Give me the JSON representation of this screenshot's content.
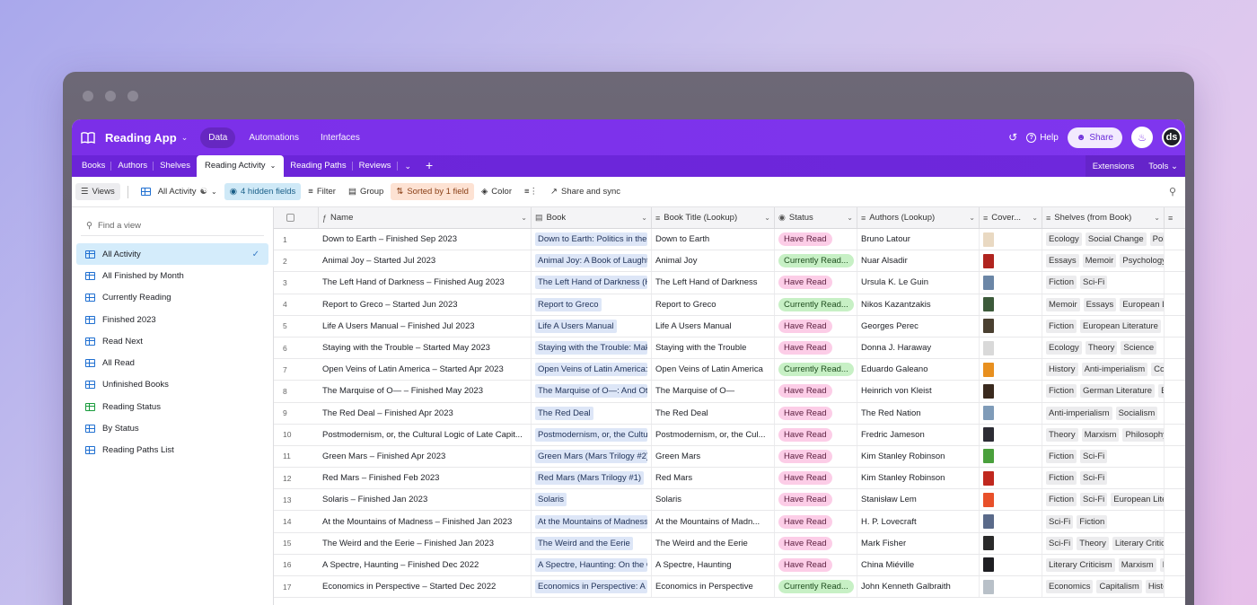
{
  "app": {
    "title": "Reading App",
    "nav": [
      "Data",
      "Automations",
      "Interfaces"
    ],
    "help_label": "Help",
    "share_label": "Share",
    "avatar_initials": "ds",
    "accent_color": "#7b2fe8"
  },
  "tabs": {
    "items": [
      "Books",
      "Authors",
      "Shelves",
      "Reading Activity",
      "Reading Paths",
      "Reviews"
    ],
    "active": "Reading Activity",
    "extensions_label": "Extensions",
    "tools_label": "Tools"
  },
  "toolbar": {
    "views_label": "Views",
    "current_view": "All Activity",
    "hidden_fields": "4 hidden fields",
    "filter": "Filter",
    "group": "Group",
    "sorted": "Sorted by 1 field",
    "color": "Color",
    "share_sync": "Share and sync"
  },
  "sidebar": {
    "find_placeholder": "Find a view",
    "views": [
      {
        "label": "All Activity",
        "icon": "grid-icon",
        "active": true
      },
      {
        "label": "All Finished by Month",
        "icon": "grid-icon"
      },
      {
        "label": "Currently Reading",
        "icon": "grid-icon"
      },
      {
        "label": "Finished 2023",
        "icon": "grid-icon"
      },
      {
        "label": "Read Next",
        "icon": "grid-icon"
      },
      {
        "label": "All Read",
        "icon": "grid-icon"
      },
      {
        "label": "Unfinished Books",
        "icon": "grid-icon"
      },
      {
        "label": "Reading Status",
        "icon": "kanban-icon"
      },
      {
        "label": "By Status",
        "icon": "grid-icon"
      },
      {
        "label": "Reading Paths List",
        "icon": "list-icon"
      }
    ]
  },
  "grid": {
    "columns": [
      "Name",
      "Book",
      "Book Title (Lookup)",
      "Status",
      "Authors (Lookup)",
      "Cover...",
      "Shelves (from Book)"
    ],
    "rows": [
      {
        "n": "1",
        "name": "Down to Earth – Finished Sep 2023",
        "book": "Down to Earth: Politics in the",
        "title": "Down to Earth",
        "status": "Have Read",
        "author": "Bruno Latour",
        "cover": "#e9d9c2",
        "shelves": [
          "Ecology",
          "Social Change",
          "Politics"
        ]
      },
      {
        "n": "2",
        "name": "Animal Joy – Started Jul 2023",
        "book": "Animal Joy: A Book of Laughte",
        "title": "Animal Joy",
        "status": "Currently Read...",
        "author": "Nuar Alsadir",
        "cover": "#b0241f",
        "shelves": [
          "Essays",
          "Memoir",
          "Psychology"
        ]
      },
      {
        "n": "3",
        "name": "The Left Hand of Darkness – Finished Aug 2023",
        "book": "The Left Hand of Darkness (H",
        "title": "The Left Hand of Darkness",
        "status": "Have Read",
        "author": "Ursula K. Le Guin",
        "cover": "#6b86a6",
        "shelves": [
          "Fiction",
          "Sci-Fi"
        ]
      },
      {
        "n": "4",
        "name": "Report to Greco – Started Jun 2023",
        "book": "Report to Greco",
        "title": "Report to Greco",
        "status": "Currently Read...",
        "author": "Nikos Kazantzakis",
        "cover": "#3c5a3a",
        "shelves": [
          "Memoir",
          "Essays",
          "European Li"
        ]
      },
      {
        "n": "5",
        "name": "Life A Users Manual – Finished Jul 2023",
        "book": "Life A Users Manual",
        "title": "Life A Users Manual",
        "status": "Have Read",
        "author": "Georges Perec",
        "cover": "#4a4030",
        "shelves": [
          "Fiction",
          "European Literature"
        ]
      },
      {
        "n": "6",
        "name": "Staying with the Trouble – Started May 2023",
        "book": "Staying with the Trouble: Mak",
        "title": "Staying with the Trouble",
        "status": "Have Read",
        "author": "Donna J. Haraway",
        "cover": "#d9d9d9",
        "shelves": [
          "Ecology",
          "Theory",
          "Science"
        ]
      },
      {
        "n": "7",
        "name": "Open Veins of Latin America – Started Apr 2023",
        "book": "Open Veins of Latin America:",
        "title": "Open Veins of Latin America",
        "status": "Currently Read...",
        "author": "Eduardo Galeano",
        "cover": "#e8901f",
        "shelves": [
          "History",
          "Anti-imperialism",
          "Co"
        ]
      },
      {
        "n": "8",
        "name": "The Marquise of O— – Finished May 2023",
        "book": "The Marquise of O—: And Ot",
        "title": "The Marquise of O—",
        "status": "Have Read",
        "author": "Heinrich von Kleist",
        "cover": "#3a2a1e",
        "shelves": [
          "Fiction",
          "German Literature",
          "E"
        ]
      },
      {
        "n": "9",
        "name": "The Red Deal – Finished Apr 2023",
        "book": "The Red Deal",
        "title": "The Red Deal",
        "status": "Have Read",
        "author": "The Red Nation",
        "cover": "#7f9bb8",
        "shelves": [
          "Anti-imperialism",
          "Socialism"
        ]
      },
      {
        "n": "10",
        "name": "Postmodernism, or, the Cultural Logic of Late Capit...",
        "book": "Postmodernism, or, the Cultu",
        "title": "Postmodernism, or, the Cul...",
        "status": "Have Read",
        "author": "Fredric Jameson",
        "cover": "#2c2c34",
        "shelves": [
          "Theory",
          "Marxism",
          "Philosophy"
        ]
      },
      {
        "n": "11",
        "name": "Green Mars – Finished Apr 2023",
        "book": "Green Mars (Mars Trilogy #2)",
        "title": "Green Mars",
        "status": "Have Read",
        "author": "Kim Stanley Robinson",
        "cover": "#4aa03c",
        "shelves": [
          "Fiction",
          "Sci-Fi"
        ]
      },
      {
        "n": "12",
        "name": "Red Mars – Finished Feb 2023",
        "book": "Red Mars (Mars Trilogy #1)",
        "title": "Red Mars",
        "status": "Have Read",
        "author": "Kim Stanley Robinson",
        "cover": "#c0281e",
        "shelves": [
          "Fiction",
          "Sci-Fi"
        ]
      },
      {
        "n": "13",
        "name": "Solaris – Finished Jan 2023",
        "book": "Solaris",
        "title": "Solaris",
        "status": "Have Read",
        "author": "Stanisław Lem",
        "cover": "#e8502a",
        "shelves": [
          "Fiction",
          "Sci-Fi",
          "European Lite"
        ]
      },
      {
        "n": "14",
        "name": "At the Mountains of Madness – Finished Jan 2023",
        "book": "At the Mountains of Madness",
        "title": "At the Mountains of Madn...",
        "status": "Have Read",
        "author": "H. P. Lovecraft",
        "cover": "#5a6a8a",
        "shelves": [
          "Sci-Fi",
          "Fiction"
        ]
      },
      {
        "n": "15",
        "name": "The Weird and the Eerie – Finished Jan 2023",
        "book": "The Weird and the Eerie",
        "title": "The Weird and the Eerie",
        "status": "Have Read",
        "author": "Mark Fisher",
        "cover": "#2a2a2a",
        "shelves": [
          "Sci-Fi",
          "Theory",
          "Literary Critic"
        ]
      },
      {
        "n": "16",
        "name": "A Spectre, Haunting – Finished Dec 2022",
        "book": "A Spectre, Haunting: On the C",
        "title": "A Spectre, Haunting",
        "status": "Have Read",
        "author": "China Miéville",
        "cover": "#1e1e22",
        "shelves": [
          "Literary Criticism",
          "Marxism",
          "I"
        ]
      },
      {
        "n": "17",
        "name": "Economics in Perspective – Started Dec 2022",
        "book": "Economics in Perspective: A C",
        "title": "Economics in Perspective",
        "status": "Currently Read...",
        "author": "John Kenneth Galbraith",
        "cover": "#b8c0c8",
        "shelves": [
          "Economics",
          "Capitalism",
          "Histo"
        ]
      }
    ]
  }
}
